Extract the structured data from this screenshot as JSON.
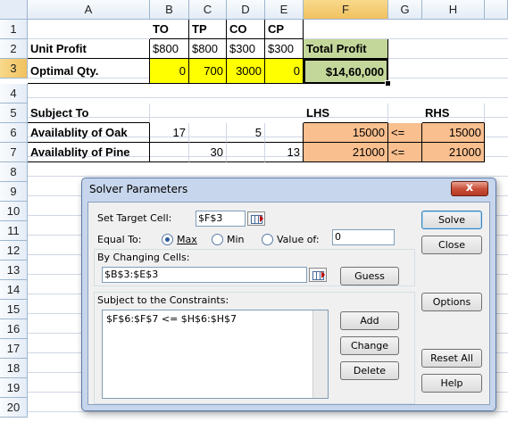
{
  "columns": [
    "A",
    "B",
    "C",
    "D",
    "E",
    "F",
    "G",
    "H"
  ],
  "rows": [
    "1",
    "2",
    "3",
    "4",
    "5",
    "6",
    "7",
    "8",
    "9",
    "10",
    "11",
    "12",
    "13",
    "14",
    "15",
    "16",
    "17",
    "18",
    "19",
    "20"
  ],
  "sheet": {
    "r1": {
      "b": "TO",
      "c": "TP",
      "d": "CO",
      "e": "CP"
    },
    "r2": {
      "a": "Unit Profit",
      "b": "$800",
      "c": "$800",
      "d": "$300",
      "e": "$300",
      "f": "Total Profit"
    },
    "r3": {
      "a": "Optimal Qty.",
      "b": "0",
      "c": "700",
      "d": "3000",
      "e": "0",
      "f": "$14,60,000"
    },
    "r5": {
      "a": "Subject To",
      "f": "LHS",
      "h": "RHS"
    },
    "r6": {
      "a": "Availablity of Oak",
      "b": "17",
      "d": "5",
      "f": "15000",
      "g": "<=",
      "h": "15000"
    },
    "r7": {
      "a": "Availablity of Pine",
      "c": "30",
      "e": "13",
      "f": "21000",
      "g": "<=",
      "h": "21000"
    }
  },
  "colors": {
    "yellow": "#ffff00",
    "green": "#c4d79b",
    "salmon": "#fabf8f"
  },
  "dialog": {
    "title": "Solver Parameters",
    "close_label": "x",
    "target_label": "Set Target Cell:",
    "target_value": "$F$3",
    "equal_to_label": "Equal To:",
    "max_label": "Max",
    "min_label": "Min",
    "value_of_label": "Value of:",
    "value_of_value": "0",
    "selected_option": "Max",
    "changing_cells_label": "By Changing Cells:",
    "changing_cells_value": "$B$3:$E$3",
    "constraints_label": "Subject to the Constraints:",
    "constraints": [
      "$F$6:$F$7 <= $H$6:$H$7"
    ],
    "buttons": {
      "solve": "Solve",
      "close": "Close",
      "guess": "Guess",
      "options": "Options",
      "add": "Add",
      "change": "Change",
      "delete": "Delete",
      "reset_all": "Reset All",
      "help": "Help"
    },
    "icons": {
      "ref": "collapse-dialog-icon",
      "close": "close-icon"
    }
  }
}
